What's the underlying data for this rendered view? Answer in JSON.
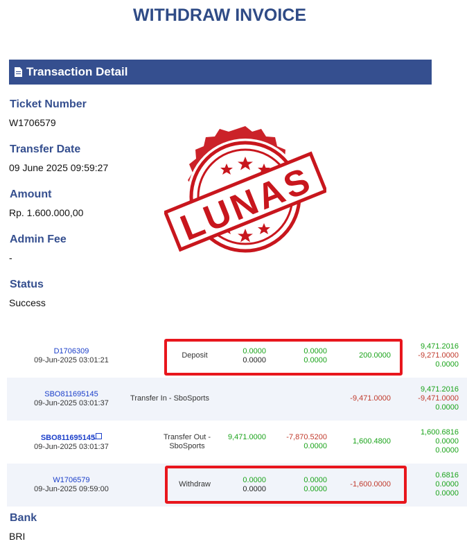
{
  "title": "WITHDRAW INVOICE",
  "section": {
    "label": "Transaction Detail",
    "icon": "document-icon"
  },
  "fields": {
    "ticket_label": "Ticket Number",
    "ticket_value": "W1706579",
    "transfer_date_label": "Transfer Date",
    "transfer_date_value": "09 June 2025 09:59:27",
    "amount_label": "Amount",
    "amount_value": "Rp. 1.600.000,00",
    "admin_fee_label": "Admin Fee",
    "admin_fee_value": "-",
    "status_label": "Status",
    "status_value": "Success",
    "bank_label": "Bank",
    "bank_value": "BRI"
  },
  "stamp": {
    "text": "LUNAS",
    "color": "#c8161d"
  },
  "transactions": [
    {
      "ref": "D1706309",
      "date": "09-Jun-2025 03:01:21",
      "type": "Deposit",
      "col1": [
        "0.0000",
        "0.0000"
      ],
      "col2": [
        "0.0000",
        "0.0000"
      ],
      "col3": "200.0000",
      "balance": [
        "9,471.2016",
        "-9,271.0000",
        "0.0000"
      ]
    },
    {
      "ref": "SBO811695145",
      "date": "09-Jun-2025 03:01:37",
      "type": "Transfer In - SboSports",
      "col3": "-9,471.0000",
      "balance": [
        "9,471.2016",
        "-9,471.0000",
        "0.0000"
      ]
    },
    {
      "ref": "SBO811695145",
      "date": "09-Jun-2025 03:01:37",
      "type_line1": "Transfer Out -",
      "type_line2": "SboSports",
      "col1": "9,471.0000",
      "col2": [
        "-7,870.5200",
        "0.0000"
      ],
      "col3": "1,600.4800",
      "balance": [
        "1,600.6816",
        "0.0000",
        "0.0000"
      ]
    },
    {
      "ref": "W1706579",
      "date": "09-Jun-2025 09:59:00",
      "type": "Withdraw",
      "col1": [
        "0.0000",
        "0.0000"
      ],
      "col2": [
        "0.0000",
        "0.0000"
      ],
      "col3": "-1,600.0000",
      "balance": [
        "0.6816",
        "0.0000",
        "0.0000"
      ]
    }
  ]
}
